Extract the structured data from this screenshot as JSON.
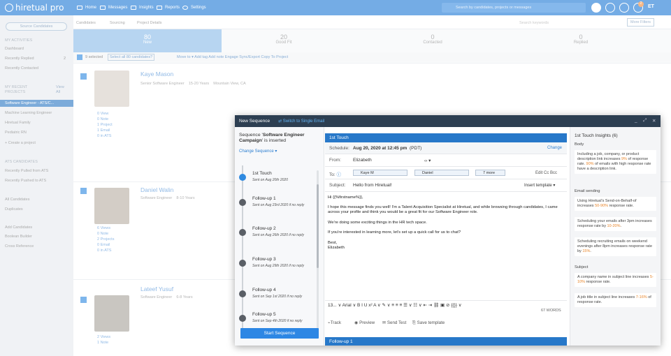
{
  "app": {
    "logo_text": "hiretual pro",
    "nav": [
      "Home",
      "Messages",
      "Insights",
      "Reports",
      "Settings"
    ],
    "search_placeholder": "Search by candidates, projects or messages",
    "notif_count": "2",
    "avatar_initials": "ET"
  },
  "sidebar": {
    "source_button": "Source Candidates",
    "my_activities": "MY ACTIVITIES",
    "dashboard": "Dashboard",
    "recently_replied": "Recently Replied",
    "recently_replied_count": "2",
    "recently_contacted": "Recently Contacted",
    "my_recent_projects": "MY RECENT PROJECTS",
    "view_all": "View All",
    "projects": [
      "Software Engineer - ATS/C...",
      "Machine Learning Engineer",
      "Hiretual Family",
      "Pediatric RN"
    ],
    "create_project": "+ Create a project",
    "ats_candidates": "ATS CANDIDATES",
    "recently_pulled": "Recently Pulled from ATS",
    "recently_pushed": "Recently Pushed to ATS",
    "all_candidates": "All Candidates",
    "duplicates": "Duplicates",
    "add_candidates": "Add Candidates",
    "boolean_builder": "Boolean Builder",
    "cross_reference": "Cross Reference"
  },
  "main": {
    "tabs": [
      "Candidates",
      "Sourcing",
      "Project Details"
    ],
    "search_keywords": "Search keywords",
    "more_filters": "More Filters",
    "stats": [
      {
        "value": "80",
        "label": "New"
      },
      {
        "value": "20",
        "label": "Good Fit"
      },
      {
        "value": "0",
        "label": "Contacted"
      },
      {
        "value": "0",
        "label": "Replied"
      }
    ],
    "selection": "9 selected",
    "select_all": "Select all 80 candidates?",
    "actions": "Move to ▾   Add tag   Add note   Engage   Sync/Export   Copy To Project",
    "candidates": [
      {
        "name": "Kaye Mason",
        "title": "Senior Software Engineer",
        "exp": "15-20 Years",
        "loc": "Mountain View, CA",
        "views": "0 View",
        "notes": "0 Note",
        "projects": "1 Project",
        "emails": "1 Email",
        "ats": "0 in ATS"
      },
      {
        "name": "Daniel Walin",
        "title": "Software Engineer",
        "exp": "8-10 Years",
        "loc": "",
        "views": "6 Views",
        "notes": "0 Note",
        "projects": "2 Projects",
        "emails": "0 Email",
        "ats": "0 in ATS"
      },
      {
        "name": "Lateef Yusuf",
        "title": "Software Engineer",
        "exp": "6-8 Years",
        "loc": "",
        "views": "2 Views",
        "notes": "1 Note",
        "projects": "",
        "emails": "",
        "ats": ""
      }
    ]
  },
  "modal": {
    "title": "New Sequence",
    "switch": "⇄ Switch to Single Email",
    "seq_prefix": "Sequence '",
    "seq_name": "Software Engineer Campaign",
    "seq_suffix": "' is inserted",
    "change_sequence": "Change Sequence ▾",
    "steps": [
      {
        "title": "1st Touch",
        "sub": "Sent on Aug 20th 2020"
      },
      {
        "title": "Follow-up 1",
        "sub": "Sent on Aug 23rd 2020  if no reply"
      },
      {
        "title": "Follow-up 2",
        "sub": "Sent on Aug 26th 2020  if no reply"
      },
      {
        "title": "Follow-up 3",
        "sub": "Sent on Aug 29th 2020  if no reply"
      },
      {
        "title": "Follow-up 4",
        "sub": "Sent on Sep 1st 2020  if no reply"
      },
      {
        "title": "Follow-up 5",
        "sub": "Sent on Sep 4th 2020  if no reply"
      }
    ],
    "start_button": "Start Sequence",
    "tab_label": "1st Touch",
    "schedule_label": "Schedule:",
    "schedule_value": "Aug 20, 2020 at 12:45 pm",
    "schedule_tz": "(PDT)",
    "change": "Change",
    "from_label": "From:",
    "from_value": "Elizabeth",
    "to_label": "To:",
    "to_chips": [
      "Kaye M",
      "Daniel",
      "7 more"
    ],
    "to_extra": "Edit  Cc  Bcc",
    "subject_label": "Subject:",
    "subject_value": "Hello from Hiretual!",
    "insert_template": "Insert template ▾",
    "body": [
      "Hi {{%firstname%}},",
      "I hope this message finds you well! I'm a Talent Acquisition Specialist at Hiretual, and while browsing through candidates, I came across your profile and think you would be a great fit for our Software Engineer role.",
      "We're doing some exciting things in the HR tech space.",
      "If you're interested in learning more, let's set up a quick call for us to chat?",
      "Best,",
      "Elizabeth"
    ],
    "toolbar": "13... ∨  Arial ∨  B  I  U  x²  A ∨  ✎ ∨  ≡  ≡  ≡  ☰ ∨  ☷ ∨  ⇤  ⇥  ⛓  ▣  ⊘  {{}} ∨",
    "words": "67 WORDS",
    "track": "⌁Track",
    "preview": "◉ Preview",
    "send_test": "✉ Send Test",
    "save_template": "⎘ Save template",
    "next_tab": "Follow-up 1",
    "insights_title": "1st Touch Insights (6)",
    "insights": [
      {
        "section": "Body"
      },
      {
        "pre": "Including a job, company, or product description link increases ",
        "hl": "9%",
        "post": " of response rate. ",
        "hl2": "90%",
        "post2": " of emails with high response rate have a description link."
      },
      {
        "section": "Email sending"
      },
      {
        "pre": "Using Hiretual's Send-on-Behalf-of increases ",
        "hl": "50-90%",
        "post": " response rate."
      },
      {
        "pre": "Scheduling your emails after 3pm increases response rate by ",
        "hl": "10-20%",
        "post": "."
      },
      {
        "pre": "Scheduling recruiting emails on weekend evenings after 8pm increases response rate by ",
        "hl": "15%",
        "post": "."
      },
      {
        "section": "Subject"
      },
      {
        "pre": "A company name in subject line increases ",
        "hl": "5-10%",
        "post": " response rate."
      },
      {
        "pre": "A job title in subject line increases ",
        "hl": "7-16%",
        "post": " of response rate."
      }
    ]
  },
  "colors": {
    "primary": "#1f7ad6",
    "modal_header": "#2d3f52",
    "highlight": "#e8852a"
  }
}
